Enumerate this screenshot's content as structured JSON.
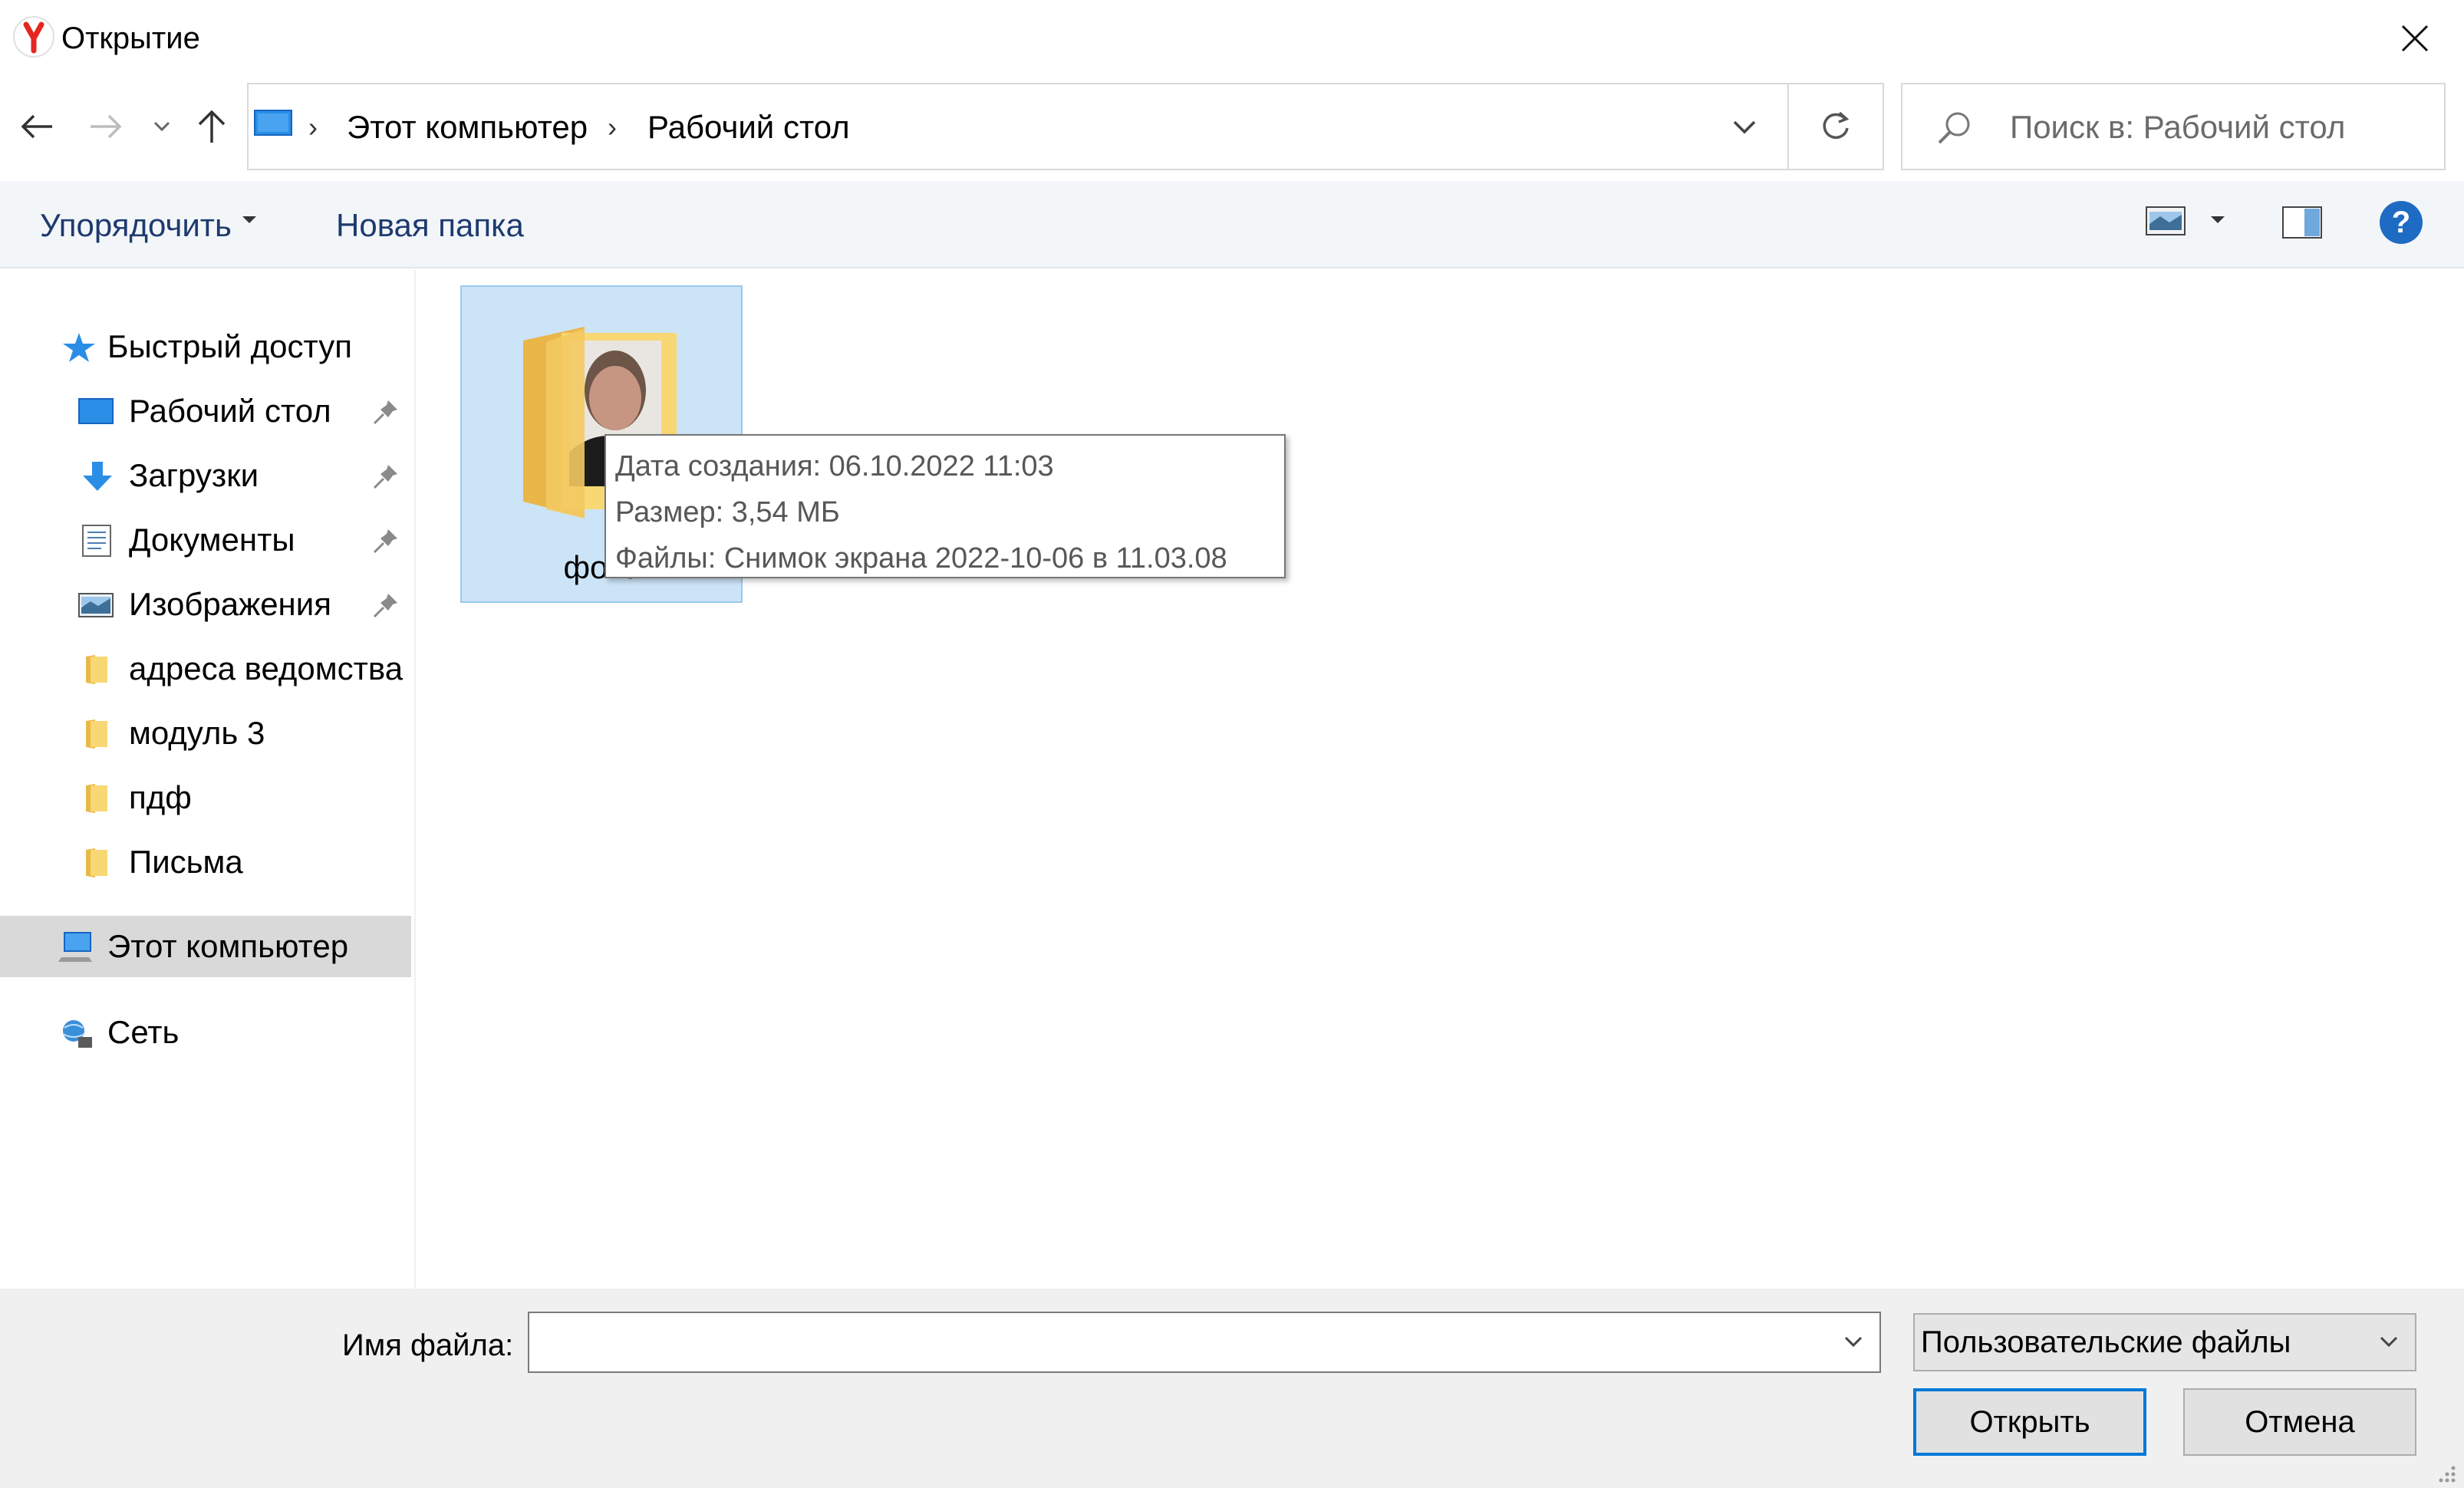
{
  "window": {
    "title": "Открытие"
  },
  "address": {
    "breadcrumbs": [
      "Этот компьютер",
      "Рабочий стол"
    ],
    "search_placeholder": "Поиск в: Рабочий стол"
  },
  "toolbar": {
    "organize_label": "Упорядочить",
    "new_folder_label": "Новая папка"
  },
  "sidebar": {
    "quick_access": "Быстрый доступ",
    "items": [
      {
        "label": "Рабочий стол",
        "icon": "desktop-icon",
        "pinned": true
      },
      {
        "label": "Загрузки",
        "icon": "download-icon",
        "pinned": true
      },
      {
        "label": "Документы",
        "icon": "documents-icon",
        "pinned": true
      },
      {
        "label": "Изображения",
        "icon": "pictures-icon",
        "pinned": true
      },
      {
        "label": "адреса ведомства",
        "icon": "folder-icon",
        "pinned": false
      },
      {
        "label": "модуль 3",
        "icon": "folder-icon",
        "pinned": false
      },
      {
        "label": "пдф",
        "icon": "folder-icon",
        "pinned": false
      },
      {
        "label": "Письма",
        "icon": "folder-icon",
        "pinned": false
      }
    ],
    "this_pc": "Этот компьютер",
    "network": "Сеть"
  },
  "content": {
    "folders": [
      {
        "name": "фото"
      }
    ],
    "tooltip": {
      "created": "Дата создания: 06.10.2022 11:03",
      "size": "Размер: 3,54 МБ",
      "files": "Файлы: Снимок экрана 2022-10-06 в 11.03.08"
    }
  },
  "bottom": {
    "filename_label": "Имя файла:",
    "filename_value": "",
    "filter_label": "Пользовательские файлы",
    "open_label": "Открыть",
    "cancel_label": "Отмена"
  },
  "colors": {
    "accent": "#0078d7",
    "selection": "#cce4f7",
    "toolbar_text": "#1e3a6e",
    "folder": "#f8d775"
  }
}
